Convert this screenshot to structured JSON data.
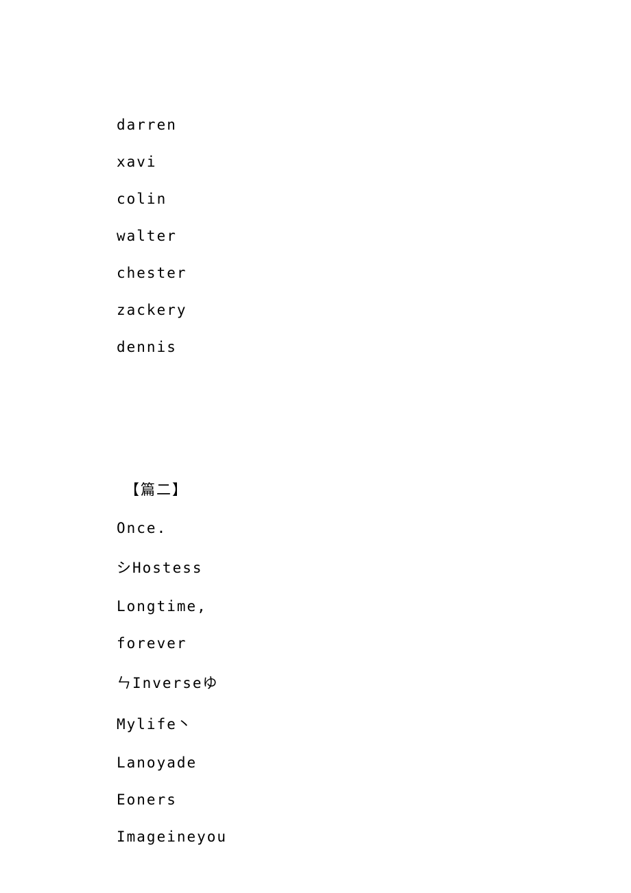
{
  "section1": {
    "lines": [
      "darren",
      "xavi",
      "colin",
      "walter",
      "chester",
      "zackery",
      "dennis"
    ]
  },
  "section2": {
    "heading": "【篇二】",
    "lines": [
      "Once.",
      "シHostess",
      "Longtime,",
      "forever",
      "ㄣInverseゆ",
      "Mylife丶",
      "Lanoyade",
      "Eoners",
      "Imageineyou"
    ]
  }
}
